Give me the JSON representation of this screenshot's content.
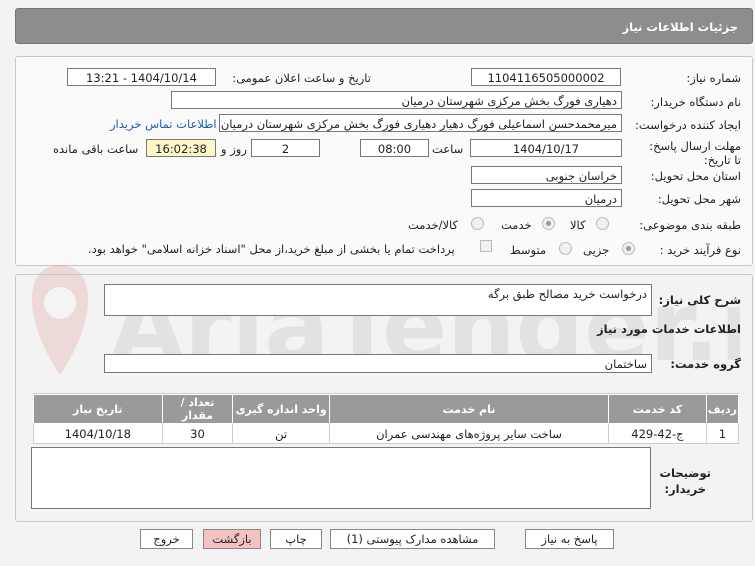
{
  "header": {
    "title": "جزئیات اطلاعات نیاز"
  },
  "form": {
    "need_number_label": "شماره نیاز:",
    "need_number": "1104116505000002",
    "announce_label": "تاریخ و ساعت اعلان عمومی:",
    "announce_value": "1404/10/14 - 13:21",
    "buyer_org_label": "نام دستگاه خریدار:",
    "buyer_org": "دهیاری فورگ بخش مرکزی شهرستان درمیان",
    "creator_label": "ایجاد کننده درخواست:",
    "creator": "میرمحمدحسن اسماعیلی فورگ دهیار دهیاری فورگ بخش مرکزی شهرستان درمیان",
    "contact_link": "اطلاعات تماس خریدار",
    "deadline_label": "مهلت ارسال پاسخ: تا تاریخ:",
    "deadline_date": "1404/10/17",
    "time_label": "ساعت",
    "deadline_time": "08:00",
    "days": "2",
    "days_label": "روز و",
    "remaining": "16:02:38",
    "remaining_label": "ساعت باقی مانده",
    "province_label": "استان محل تحویل:",
    "province": "خراسان جنوبی",
    "city_label": "شهر محل تحویل:",
    "city": "درمیان",
    "category_label": "طبقه بندی موضوعی:",
    "category_options": [
      "کالا",
      "خدمت",
      "کالا/خدمت"
    ],
    "process_label": "نوع فرآیند خرید :",
    "process_options": [
      "جزیی",
      "متوسط"
    ],
    "payment_note": "پرداخت تمام یا بخشی از مبلغ خرید،از محل \"اسناد خزانه اسلامی\" خواهد بود."
  },
  "summary": {
    "label": "شرح کلی نیاز:",
    "value": "درخواست خرید مصالح طبق برگه"
  },
  "services": {
    "heading": "اطلاعات خدمات مورد نیاز",
    "group_label": "گروه خدمت:",
    "group_value": "ساختمان",
    "columns": [
      "ردیف",
      "کد خدمت",
      "نام خدمت",
      "واحد اندازه گیری",
      "تعداد / مقدار",
      "تاریخ نیاز"
    ],
    "rows": [
      [
        "1",
        "ج-42-429",
        "ساخت سایر پروژه‌های مهندسی عمران",
        "تن",
        "30",
        "1404/10/18"
      ]
    ]
  },
  "notes": {
    "label_line1": "توضیحات",
    "label_line2": "خریدار:"
  },
  "buttons": {
    "reply": "پاسخ به نیاز",
    "attachments": "مشاهده مدارک پیوستی (1)",
    "print": "چاپ",
    "back": "بازگشت",
    "exit": "خروج"
  },
  "watermark": {
    "text": "AriaTender.neT"
  },
  "colors": {
    "title_bar": "#8d8d8d",
    "link": "#1a5fb4",
    "remaining_bg": "#fff6c8",
    "button_pink": "#f4c2c2"
  }
}
